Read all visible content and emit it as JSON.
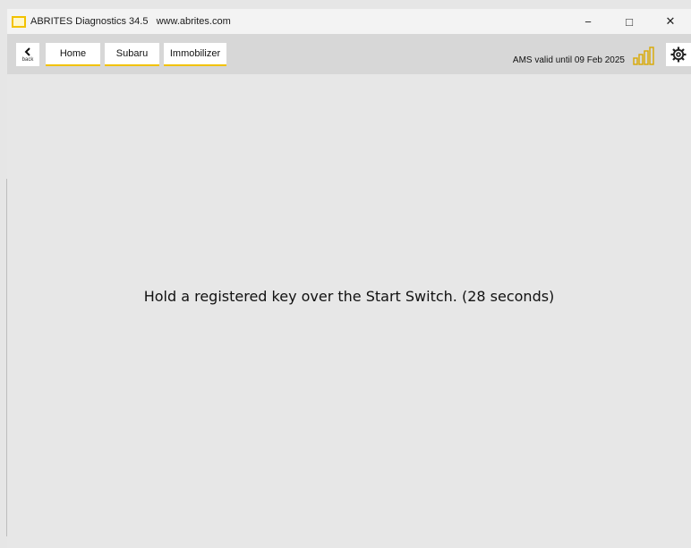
{
  "window": {
    "title": "ABRITES Diagnostics 34.5   www.abrites.com",
    "controls": {
      "minimize": "−",
      "maximize": "□",
      "close": "✕"
    }
  },
  "toolbar": {
    "back_label": "back",
    "breadcrumbs": [
      "Home",
      "Subaru",
      "Immobilizer"
    ],
    "ams_status": "AMS valid until 09 Feb 2025",
    "signal_icon": "signal-strength-icon",
    "settings_icon": "gear-icon"
  },
  "main": {
    "message": "Hold a registered key over the Start Switch. (28 seconds)"
  },
  "colors": {
    "accent": "#f2c200",
    "toolbar_bg": "#d7d7d7",
    "content_bg": "#e7e7e7"
  }
}
